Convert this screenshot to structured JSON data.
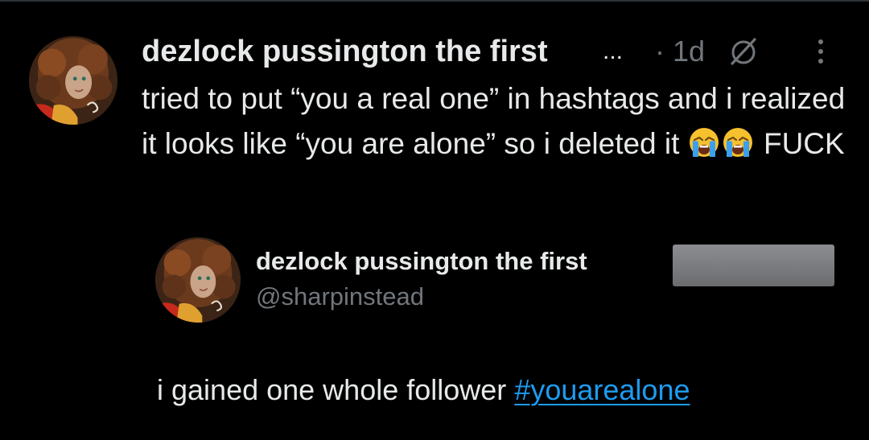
{
  "post": {
    "author_name": "dezlock pussington the first",
    "name_truncation": "...",
    "timestamp": "· 1d",
    "grok_icon": "grok-icon",
    "more_icon": "more-vertical-icon",
    "text_before_emoji": "tried to put “you a real one” in hashtags and i realized it looks like “you are alone” so i deleted it",
    "emojis": [
      "loudly-crying-face",
      "loudly-crying-face"
    ],
    "text_after_emoji": "FUCK"
  },
  "quoted_post": {
    "author_name": "dezlock pussington the first",
    "handle": "@sharpinstead",
    "text": "i gained one whole follower",
    "hashtag": "#youarealone"
  },
  "colors": {
    "background": "#000000",
    "primary_text": "#e7e9ea",
    "secondary_text": "#71767b",
    "link": "#1d9bf0"
  }
}
